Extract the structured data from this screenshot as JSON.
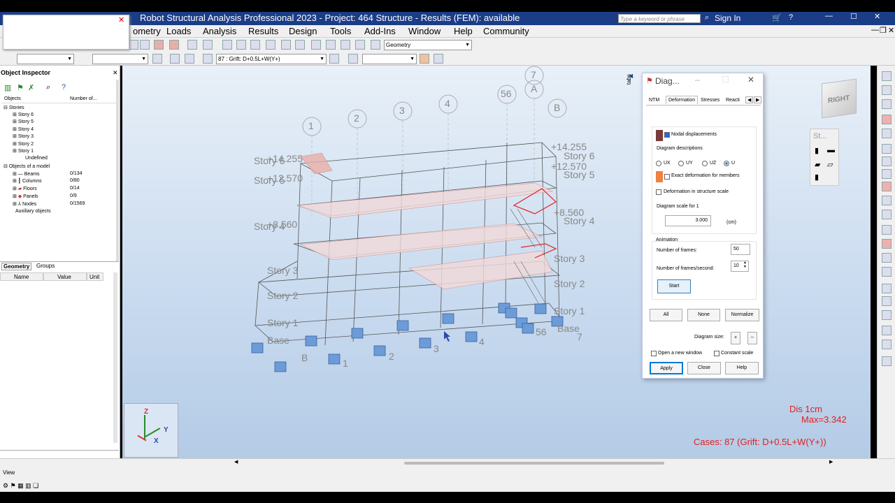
{
  "app": {
    "title": "Robot Structural Analysis Professional 2023 - Project: 464 Structure - Results (FEM): available",
    "search_placeholder": "Type a keyword or phrase",
    "sign_in": "Sign In"
  },
  "menu": [
    "ometry",
    "Loads",
    "Analysis",
    "Results",
    "Design",
    "Tools",
    "Add-Ins",
    "Window",
    "Help",
    "Community"
  ],
  "toolbar": {
    "view_combo": "Geometry",
    "case_combo": "87 : Grift: D+0.5L+W(Y+)"
  },
  "inspector": {
    "title": "Object Inspector",
    "col_objects": "Objects",
    "col_number": "Number of...",
    "stories_root": "Stories",
    "stories": [
      "Story 6",
      "Story 5",
      "Story 4",
      "Story 3",
      "Story 2",
      "Story 1"
    ],
    "undefined": "Undefined",
    "model_root": "Objects of a model",
    "model_items": [
      {
        "name": "Beams",
        "count": "0/134"
      },
      {
        "name": "Columns",
        "count": "0/80"
      },
      {
        "name": "Floors",
        "count": "0/14"
      },
      {
        "name": "Panels",
        "count": "0/9"
      },
      {
        "name": "Nodes",
        "count": "0/1569"
      }
    ],
    "auxiliary": "Auxiliary objects",
    "tab_geometry": "Geometry",
    "tab_groups": "Groups",
    "prop_name": "Name",
    "prop_value": "Value",
    "prop_unit": "Unit"
  },
  "viewport": {
    "grid_labels": [
      "1",
      "2",
      "3",
      "4",
      "56",
      "7",
      "A",
      "B"
    ],
    "bottom_grid_labels": [
      "B",
      "1",
      "2",
      "3",
      "4",
      "56",
      "7"
    ],
    "story_labels": [
      "Story 6",
      "Story 5",
      "Story 4",
      "Story 3",
      "Story 2",
      "Story 1",
      "Base"
    ],
    "left_story_labels": [
      "Story 6",
      "Story 5",
      "Story 4",
      "Story 3",
      "Story 2",
      "Story 1",
      "Base"
    ],
    "elevations": [
      "+14.255",
      "+12.570",
      "+8.560"
    ],
    "left_elevations": [
      "+14.255",
      "+12.570",
      "+8.560"
    ],
    "legend_unit": "Dis   1cm",
    "legend_max": "Max=3.342",
    "cases": "Cases: 87 (Grift: D+0.5L+W(Y+))",
    "viewcube": "RIGHT",
    "side_panel": "St...",
    "tabs_label": "tabs",
    "axis_x": "X",
    "axis_y": "Y",
    "axis_z": "Z"
  },
  "dialog": {
    "title": "Diag...",
    "tabs": [
      "NTM",
      "Deformation",
      "Stresses",
      "Reacti"
    ],
    "nodal_displacements": "Nodal displacements",
    "diagram_descriptions": "Diagram descriptions",
    "radio_ux": "UX",
    "radio_uy": "UY",
    "radio_uz": "UZ",
    "radio_u": "U",
    "exact_deformation": "Exact deformation for members",
    "deformation_scale": "Deformation in structure scale",
    "scale_label": "Diagram scale for 1",
    "scale_value": "3.000",
    "scale_unit": "(cm)",
    "animation": "Animation",
    "frames_label": "Number of frames:",
    "frames_value": "50",
    "fps_label": "Number of frames/second:",
    "fps_value": "10",
    "start": "Start",
    "all": "All",
    "none": "None",
    "normalize": "Normalize",
    "diagram_size": "Diagram size:",
    "size_plus": "+",
    "size_minus": "--",
    "open_new_window": "Open a new window",
    "constant_scale": "Constant scale",
    "apply": "Apply",
    "close": "Close",
    "help": "Help"
  },
  "status": {
    "view": "View"
  },
  "colors": {
    "titlebar": "#1b3d87",
    "result_red": "#e02020",
    "accent_blue": "#0078d7"
  }
}
